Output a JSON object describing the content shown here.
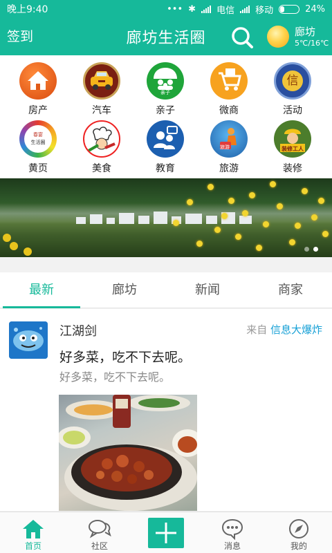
{
  "status_bar": {
    "time": "晚上9:40",
    "carrier_1": "电信",
    "carrier_2": "移动",
    "battery": "24%",
    "battery_level": 0.24
  },
  "header": {
    "signin_label": "签到",
    "title": "廊坊生活圈",
    "weather": {
      "city": "廊坊",
      "temp": "5℃/16℃"
    }
  },
  "categories": [
    {
      "label": "房产",
      "icon": "house-icon"
    },
    {
      "label": "汽车",
      "icon": "car-icon"
    },
    {
      "label": "亲子",
      "icon": "family-icon"
    },
    {
      "label": "微商",
      "icon": "shopping-cart-icon"
    },
    {
      "label": "活动",
      "icon": "activity-badge-icon"
    },
    {
      "label": "黄页",
      "icon": "yellow-pages-icon"
    },
    {
      "label": "美食",
      "icon": "chef-icon"
    },
    {
      "label": "教育",
      "icon": "education-icon"
    },
    {
      "label": "旅游",
      "icon": "travel-icon"
    },
    {
      "label": "装修",
      "icon": "renovation-worker-icon"
    }
  ],
  "category_icon_text": {
    "family": "亲子",
    "activity": "信",
    "yellowpages_1": "春宴",
    "yellowpages_2": "生活圈",
    "travel": "旅游",
    "renovation": "装修工人"
  },
  "banner": {
    "slides": 2,
    "active_slide": 1
  },
  "tabs": [
    "最新",
    "廊坊",
    "新闻",
    "商家"
  ],
  "active_tab": 0,
  "post": {
    "username": "江湖剑",
    "source_prefix": "来自",
    "source_name": "信息大爆炸",
    "title": "好多菜，吃不下去呢。",
    "body": "好多菜，吃不下去呢。"
  },
  "bottom_nav": [
    {
      "label": "首页",
      "icon": "home-icon"
    },
    {
      "label": "社区",
      "icon": "chat-bubbles-icon"
    },
    {
      "label": "",
      "icon": "plus-icon"
    },
    {
      "label": "消息",
      "icon": "message-icon"
    },
    {
      "label": "我的",
      "icon": "compass-icon"
    }
  ],
  "colors": {
    "brand": "#16b99a",
    "link": "#16a0d6"
  }
}
